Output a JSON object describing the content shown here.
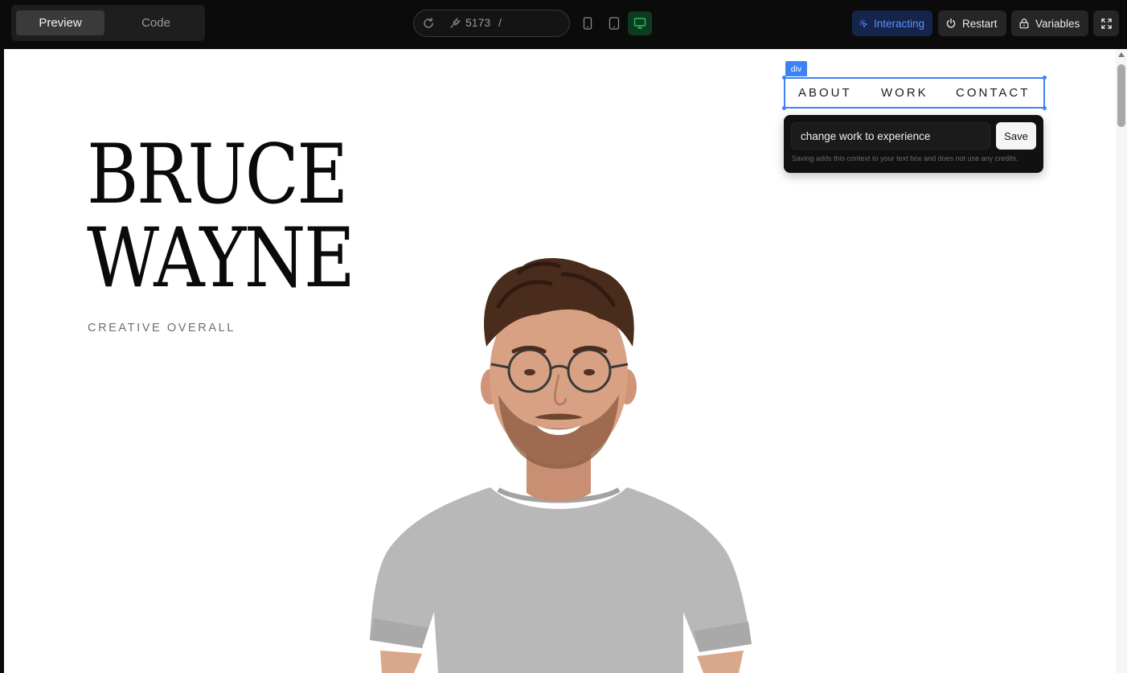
{
  "toolbar": {
    "tabs": [
      {
        "label": "Preview",
        "active": true
      },
      {
        "label": "Code",
        "active": false
      }
    ],
    "url": {
      "port": "5173",
      "path": "/"
    },
    "devices": [
      {
        "icon": "phone-icon",
        "active": false
      },
      {
        "icon": "tablet-icon",
        "active": false
      },
      {
        "icon": "desktop-icon",
        "active": true
      }
    ],
    "interacting_label": "Interacting",
    "restart_label": "Restart",
    "variables_label": "Variables",
    "accent": "#5b93ff",
    "desktop_active_color": "#22c55e"
  },
  "page": {
    "name_line1": "BRUCE",
    "name_line2": "WAYNE",
    "subtitle": "CREATIVE OVERALL",
    "nav": [
      "ABOUT",
      "WORK",
      "CONTACT"
    ],
    "portrait_icon": "person-portrait-image"
  },
  "editor": {
    "element_tag": "div",
    "selection_color": "#3b82f6",
    "prompt_value": "change work to experience",
    "save_label": "Save",
    "hint": "Saving adds this context to your text box and does not use any credits."
  }
}
